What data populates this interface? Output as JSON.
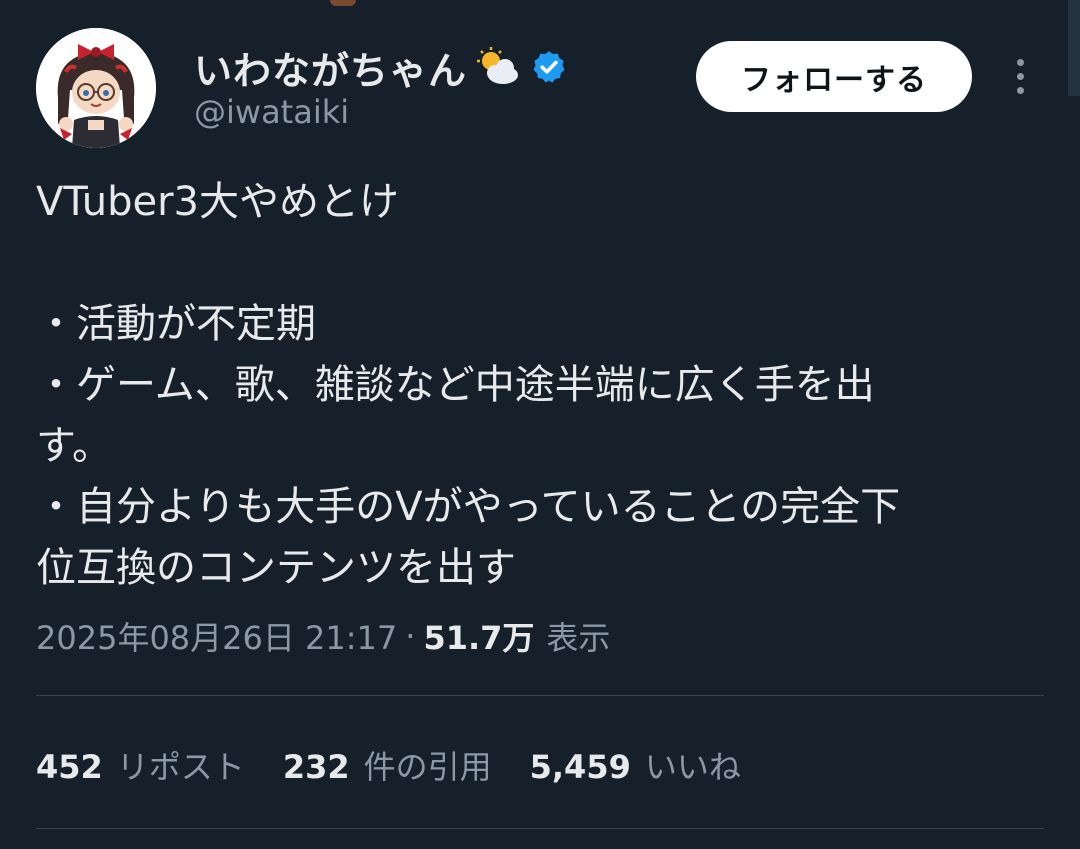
{
  "author": {
    "display_name": "いわながちゃん",
    "handle": "@iwataiki",
    "avatar_icon": "avatar-illustration",
    "name_emoji": "sun-behind-cloud-icon",
    "verified_badge": "verified-badge-icon",
    "verified_color": "#1d9bf0"
  },
  "actions": {
    "follow_label": "フォローする",
    "more_icon": "more-vertical-icon"
  },
  "tweet": {
    "lines": [
      "VTuber3大やめとけ",
      "",
      "・活動が不定期",
      "・ゲーム、歌、雑談など中途半端に広く手を出",
      "す。",
      "・自分よりも大手のVがやっていることの完全下",
      "位互換のコンテンツを出す"
    ]
  },
  "meta": {
    "timestamp": "2025年08月26日 21:17",
    "separator": "·",
    "views_count": "51.7万",
    "views_label": "表示"
  },
  "stats": [
    {
      "count": "452",
      "label": "リポスト"
    },
    {
      "count": "232",
      "label": "件の引用"
    },
    {
      "count": "5,459",
      "label": "いいね"
    }
  ],
  "colors": {
    "background": "#15202b",
    "text_primary": "#e7e9ea",
    "text_secondary": "#8b98a5",
    "divider": "#38444d",
    "follow_bg": "#ffffff"
  }
}
